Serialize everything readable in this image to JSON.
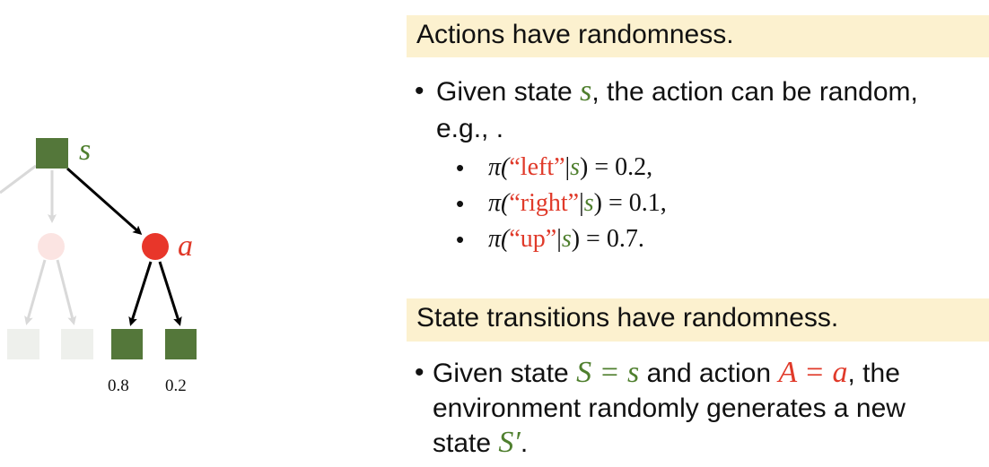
{
  "diagram": {
    "state_label": "s",
    "action_label": "a",
    "probabilities": [
      "0.8",
      "0.2"
    ],
    "colors": {
      "state_active": "#54773a",
      "state_faded": "#eef0ec",
      "action_active": "#e8362a",
      "action_faded": "#fbe4e2",
      "edge_active": "#000000",
      "edge_faded": "#d9d9d9",
      "label_green": "#4f7f2e",
      "label_red": "#e03a2a"
    }
  },
  "actions_section": {
    "heading": "Actions have randomness.",
    "bullet_prefix": "Given state ",
    "bullet_var": "s",
    "bullet_suffix": ", the action can be random,",
    "bullet_line2": "e.g., .",
    "policies": [
      {
        "pi": "π(",
        "action": "“left”",
        "bar": "|",
        "state": "s",
        "rest": ") = 0.2,"
      },
      {
        "pi": "π(",
        "action": "“right”",
        "bar": "|",
        "state": "s",
        "rest": ") = 0.1,"
      },
      {
        "pi": "π(",
        "action": "“up”",
        "bar": "|",
        "state": "s",
        "rest": ") = 0.7."
      }
    ]
  },
  "transitions_section": {
    "heading": "State transitions have randomness.",
    "line1_prefix": "Given state ",
    "line1_eq1": "S = s",
    "line1_mid": " and action ",
    "line1_eq2": "A = a",
    "line1_suffix": ", the",
    "line2": "environment randomly generates a new",
    "line3_prefix": "state ",
    "line3_var": "S′",
    "line3_suffix": "."
  }
}
